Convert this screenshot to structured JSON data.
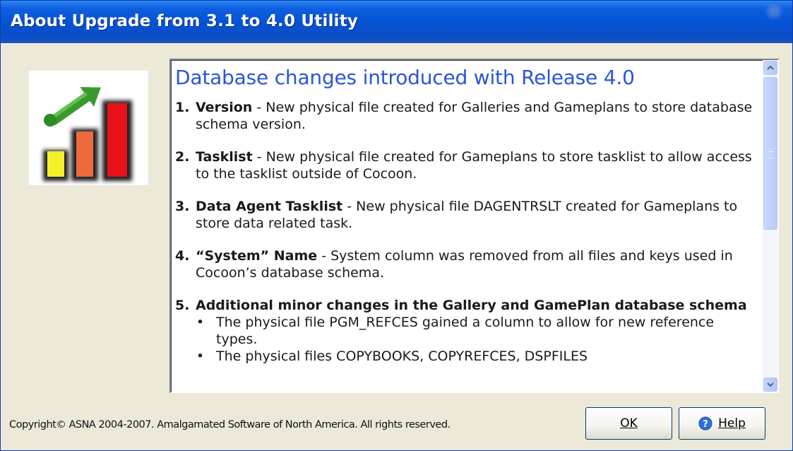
{
  "window": {
    "title": "About Upgrade from 3.1 to 4.0 Utility"
  },
  "logo": {
    "icon": "upgrade-chart-icon"
  },
  "document": {
    "heading": "Database changes introduced with Release 4.0",
    "items": [
      {
        "num": "1.",
        "term": "Version",
        "text": " - New physical file created for Galleries and Gameplans to store database schema version."
      },
      {
        "num": "2.",
        "term": "Tasklist",
        "text": " - New physical file created for Gameplans to store tasklist to allow access to the tasklist outside of Cocoon."
      },
      {
        "num": "3.",
        "term": "Data Agent Tasklist",
        "text": " - New physical file DAGENTRSLT created for Gameplans to store data related task."
      },
      {
        "num": "4.",
        "term": "“System” Name",
        "text": " - System column was removed from all files and keys used in Cocoon’s database schema."
      },
      {
        "num": "5.",
        "term": "Additional minor changes in the Gallery and GamePlan database schema",
        "text": ""
      }
    ],
    "subitems": [
      {
        "bullet": "•",
        "text": "The physical file PGM_REFCES gained a column to allow for new reference types."
      },
      {
        "bullet": "•",
        "text": "The physical files COPYBOOKS, COPYREFCES, DSPFILES"
      }
    ]
  },
  "footer": {
    "copyright": "Copyright© ASNA 2004-2007. Amalgamated Software of North America. All rights reserved.",
    "ok_label": "OK",
    "help_label": "Help"
  },
  "colors": {
    "titlebar": "#0553d6",
    "heading": "#2a55d8",
    "dialog_bg": "#ece9d8"
  }
}
